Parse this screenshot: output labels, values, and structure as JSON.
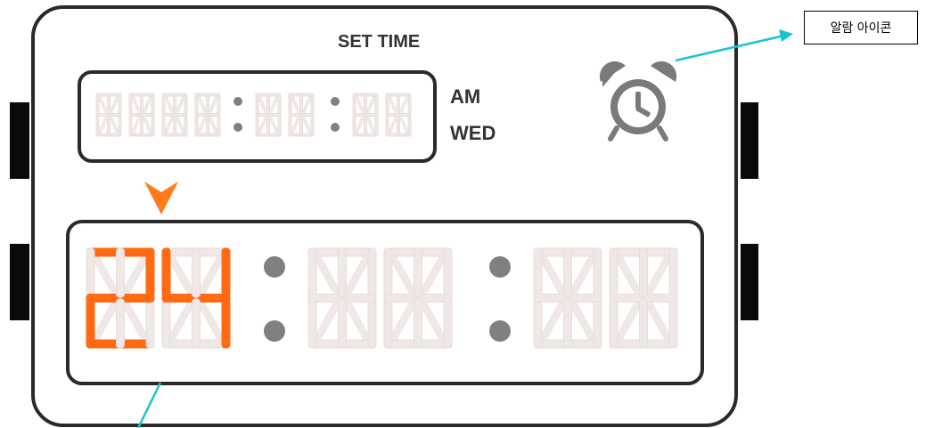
{
  "device": {
    "title": "SET TIME",
    "meridiem": "AM",
    "weekday": "WED",
    "alarm_icon": "alarm-clock-icon",
    "cursor_icon": "down-triangle-icon"
  },
  "set_time_display": {
    "hour_digits": [
      "2",
      "4"
    ],
    "minute_digits": [
      "",
      ""
    ],
    "second_digits": [
      "",
      ""
    ],
    "separator": ":"
  },
  "annotations": {
    "alarm_callout": "알람 아이콘"
  },
  "colors": {
    "active_segment": "#ff6a13",
    "inactive_segment": "#f0e8e6",
    "inactive_segment_outline": "#e9dcd8",
    "frame": "#2a2a2a",
    "icon_gray": "#7a7a7a",
    "callout_line": "#18c4cf"
  }
}
